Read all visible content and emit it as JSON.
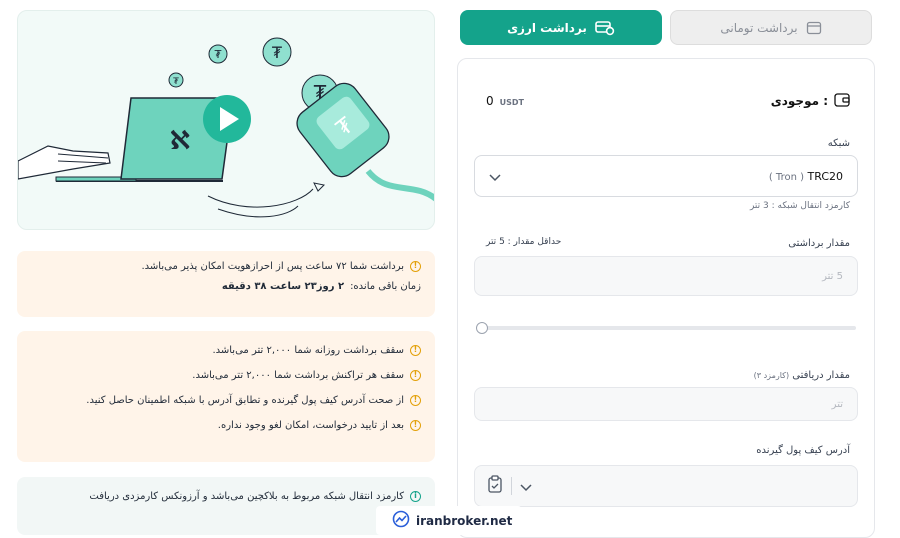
{
  "tabs": {
    "crypto_label": "برداشت ارزی",
    "toman_label": "برداشت تومانی"
  },
  "balance": {
    "label": "موجودی :",
    "value": "0",
    "unit": "USDT"
  },
  "network": {
    "label": "شبکه",
    "selected_name": "TRC20",
    "selected_sub": "( Tron )",
    "fee_note": "کارمزد انتقال شبکه : 3 تتر"
  },
  "amount": {
    "label": "مقدار برداشتی",
    "min_note": "حداقل مقدار : 5 تتر",
    "placeholder": "5 تتر",
    "slider_percent": 0
  },
  "received": {
    "label": "مقدار دریافتی",
    "fee_hint": "(کارمزد ۳)",
    "placeholder": "تتر"
  },
  "address": {
    "label": "آدرس کیف پول گیرنده"
  },
  "notice_kyc": {
    "line1": "برداشت شما ۷۲ ساعت پس از احرازهویت امکان پذیر می‌باشد.",
    "remaining_label": "زمان باقی مانده:",
    "remaining_value": "۲ روز۲۳ ساعت ۳۸ دقیقه"
  },
  "rules": [
    "سقف برداشت روزانه شما ۲,۰۰۰ تتر می‌باشد.",
    "سقف هر تراکنش برداشت شما ۲,۰۰۰ تتر می‌باشد.",
    "از صحت آدرس کیف پول گیرنده و تطابق آدرس با شبکه اطمینان حاصل کنید.",
    "بعد از تایید درخواست، امکان لغو وجود نداره."
  ],
  "info": {
    "line1": "کارمزد انتقال شبکه مربوط به بلاکچین می‌باشد و آرزونکس کارمزدی دریافت"
  },
  "watermark": {
    "text": "iranbroker.net"
  },
  "colors": {
    "accent": "#14a38b",
    "warning_bg": "#fff4e9",
    "warning_icon": "#e3a008"
  }
}
